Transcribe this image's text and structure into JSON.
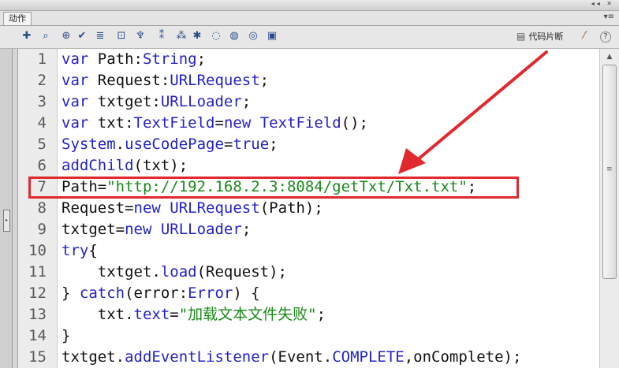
{
  "panel": {
    "tab_label": "动作",
    "window_buttons": "◂◂ ✕",
    "tab_menu_icon": "▾≡"
  },
  "toolbar": {
    "tools": [
      {
        "icon": "add-statement-icon",
        "glyph": "✚"
      },
      {
        "icon": "find-icon",
        "glyph": "⌕"
      },
      {
        "icon": "target-path-icon",
        "glyph": "⊕"
      },
      {
        "icon": "check-syntax-icon",
        "glyph": "✔"
      },
      {
        "icon": "auto-format-icon",
        "glyph": "≣"
      },
      {
        "icon": "code-hint-icon",
        "glyph": "⊡"
      },
      {
        "icon": "debug-options-icon",
        "glyph": "♆"
      },
      {
        "icon": "collapse-braces-icon",
        "glyph": "⁑"
      },
      {
        "icon": "collapse-selection-icon",
        "glyph": "⁂"
      },
      {
        "icon": "expand-all-icon",
        "glyph": "✱"
      },
      {
        "icon": "apply-block-comment-icon",
        "glyph": "◌"
      },
      {
        "icon": "apply-line-comment-icon",
        "glyph": "◍"
      },
      {
        "icon": "remove-comment-icon",
        "glyph": "◎"
      },
      {
        "icon": "show-toolbox-icon",
        "glyph": "▣"
      }
    ],
    "snippets_label": "代码片断",
    "wand_icon": "magic-wand-icon",
    "help_icon": "help-icon"
  },
  "code_lines": [
    {
      "n": "1",
      "tokens": [
        [
          "kw",
          "var"
        ],
        [
          "plain",
          " Path:"
        ],
        [
          "ty",
          "String"
        ],
        [
          "plain",
          ";"
        ]
      ]
    },
    {
      "n": "2",
      "tokens": [
        [
          "kw",
          "var"
        ],
        [
          "plain",
          " Request:"
        ],
        [
          "ty",
          "URLRequest"
        ],
        [
          "plain",
          ";"
        ]
      ]
    },
    {
      "n": "3",
      "tokens": [
        [
          "kw",
          "var"
        ],
        [
          "plain",
          " txtget:"
        ],
        [
          "ty",
          "URLLoader"
        ],
        [
          "plain",
          ";"
        ]
      ]
    },
    {
      "n": "4",
      "tokens": [
        [
          "kw",
          "var"
        ],
        [
          "plain",
          " txt:"
        ],
        [
          "ty",
          "TextField"
        ],
        [
          "plain",
          "="
        ],
        [
          "kw",
          "new"
        ],
        [
          "plain",
          " "
        ],
        [
          "ty",
          "TextField"
        ],
        [
          "plain",
          "();"
        ]
      ]
    },
    {
      "n": "5",
      "tokens": [
        [
          "ty",
          "System"
        ],
        [
          "plain",
          "."
        ],
        [
          "ty",
          "useCodePage"
        ],
        [
          "plain",
          "="
        ],
        [
          "kw",
          "true"
        ],
        [
          "plain",
          ";"
        ]
      ]
    },
    {
      "n": "6",
      "tokens": [
        [
          "ty",
          "addChild"
        ],
        [
          "plain",
          "(txt);"
        ]
      ]
    },
    {
      "n": "7",
      "tokens": [
        [
          "plain",
          "Path="
        ],
        [
          "str",
          "\"http://192.168.2.3:8084/getTxt/Txt.txt\""
        ],
        [
          "plain",
          ";"
        ]
      ]
    },
    {
      "n": "8",
      "tokens": [
        [
          "plain",
          "Request="
        ],
        [
          "kw",
          "new"
        ],
        [
          "plain",
          " "
        ],
        [
          "ty",
          "URLRequest"
        ],
        [
          "plain",
          "(Path);"
        ]
      ]
    },
    {
      "n": "9",
      "tokens": [
        [
          "plain",
          "txtget="
        ],
        [
          "kw",
          "new"
        ],
        [
          "plain",
          " "
        ],
        [
          "ty",
          "URLLoader"
        ],
        [
          "plain",
          ";"
        ]
      ]
    },
    {
      "n": "10",
      "tokens": [
        [
          "kw",
          "try"
        ],
        [
          "plain",
          "{"
        ]
      ]
    },
    {
      "n": "11",
      "tokens": [
        [
          "plain",
          "    txtget."
        ],
        [
          "ty",
          "load"
        ],
        [
          "plain",
          "(Request);"
        ]
      ]
    },
    {
      "n": "12",
      "tokens": [
        [
          "plain",
          "} "
        ],
        [
          "kw",
          "catch"
        ],
        [
          "plain",
          "(error:"
        ],
        [
          "ty",
          "Error"
        ],
        [
          "plain",
          ") {"
        ]
      ]
    },
    {
      "n": "13",
      "tokens": [
        [
          "plain",
          "    txt."
        ],
        [
          "ty",
          "text"
        ],
        [
          "plain",
          "="
        ],
        [
          "str",
          "\"加载文本文件失败\""
        ],
        [
          "plain",
          ";"
        ]
      ]
    },
    {
      "n": "14",
      "tokens": [
        [
          "plain",
          "}"
        ]
      ]
    },
    {
      "n": "15",
      "tokens": [
        [
          "plain",
          "txtget."
        ],
        [
          "ty",
          "addEventListener"
        ],
        [
          "plain",
          "(Event."
        ],
        [
          "ty",
          "COMPLETE"
        ],
        [
          "plain",
          ",onComplete);"
        ]
      ]
    }
  ],
  "colors": {
    "keyword": "#2222c8",
    "string": "#1a8a1a",
    "highlight": "#e0282e"
  }
}
